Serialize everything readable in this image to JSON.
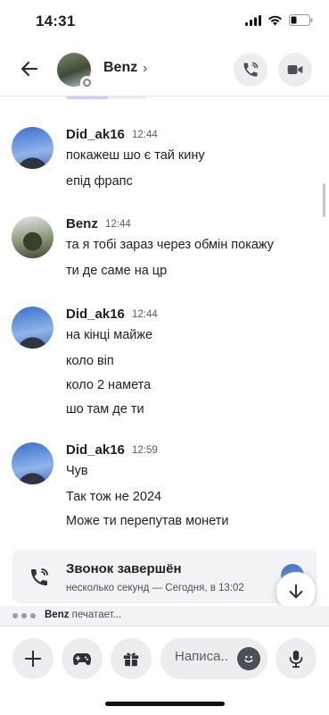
{
  "status_bar": {
    "time": "14:31"
  },
  "header": {
    "name": "Benz",
    "chevron": "›"
  },
  "messages": [
    {
      "author": "Did_ak16",
      "time": "12:44",
      "lines": [
        "покажеш шо є тай кину",
        "епід фрапс"
      ]
    },
    {
      "author": "Benz",
      "time": "12:44",
      "lines": [
        "та я тобі зараз через обмін покажу",
        "ти де саме на цр"
      ]
    },
    {
      "author": "Did_ak16",
      "time": "12:44",
      "lines": [
        "на кінці майже",
        "коло віп",
        "коло 2 намета",
        "шо там де ти"
      ]
    },
    {
      "author": "Did_ak16",
      "time": "12:59",
      "lines": [
        "Чув",
        "Так тож не 2024",
        "Може ти перепутав монети"
      ]
    }
  ],
  "call": {
    "title": "Звонок завершён",
    "subtitle": "несколько секунд — Сегодня, в 13:02"
  },
  "typing": {
    "user": "Benz",
    "text": " печатает..."
  },
  "composer": {
    "placeholder": "Написа.."
  },
  "icons": {
    "back": "arrow-left-icon",
    "call": "phone-icon",
    "video": "video-camera-icon",
    "add": "plus-icon",
    "game": "gamepad-icon",
    "gift": "gift-icon",
    "emoji": "emoji-icon",
    "mic": "microphone-icon",
    "jump": "arrow-down-icon"
  }
}
